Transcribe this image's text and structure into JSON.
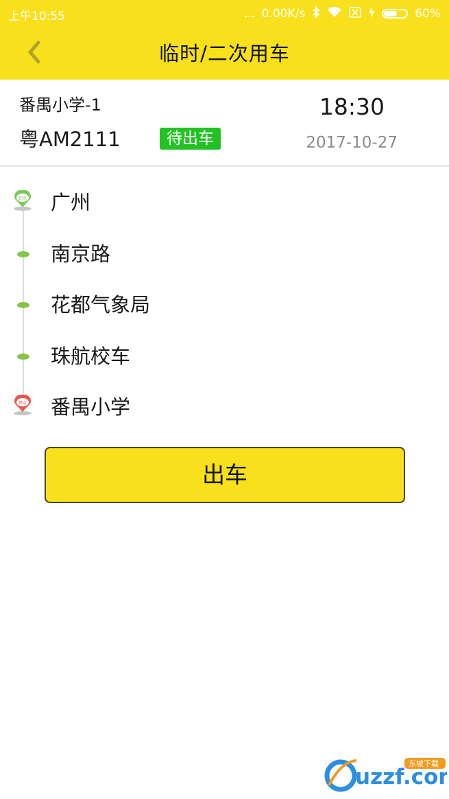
{
  "status_bar": {
    "time": "上午10:55",
    "signal_dots": "...",
    "network_speed": "0.00K/s",
    "battery_percent": "60%",
    "battery_level": 0.6,
    "icons": [
      "bluetooth-icon",
      "wifi-icon",
      "sim-off-icon",
      "charging-icon",
      "battery-icon"
    ]
  },
  "nav": {
    "title": "临时/二次用车",
    "back_icon": "chevron-left-icon"
  },
  "trip": {
    "route_name": "番禺小学-1",
    "plate": "粤AM2111",
    "status": "待出车",
    "time": "18:30",
    "date": "2017-10-27"
  },
  "stops": [
    {
      "name": "广州",
      "type": "start",
      "pin_label": "起点"
    },
    {
      "name": "南京路",
      "type": "via"
    },
    {
      "name": "花都气象局",
      "type": "via"
    },
    {
      "name": "珠航校车",
      "type": "via"
    },
    {
      "name": "番禺小学",
      "type": "end",
      "pin_label": "终点"
    }
  ],
  "actions": {
    "depart_label": "出车"
  },
  "watermark": {
    "text": "uzzf.com",
    "sub": "东坡下载"
  },
  "colors": {
    "accent_yellow": "#f8e11c",
    "status_green": "#22c224",
    "start_pin": "#7ccb5a",
    "end_pin": "#e8584f",
    "via_dot": "#86c44a"
  }
}
